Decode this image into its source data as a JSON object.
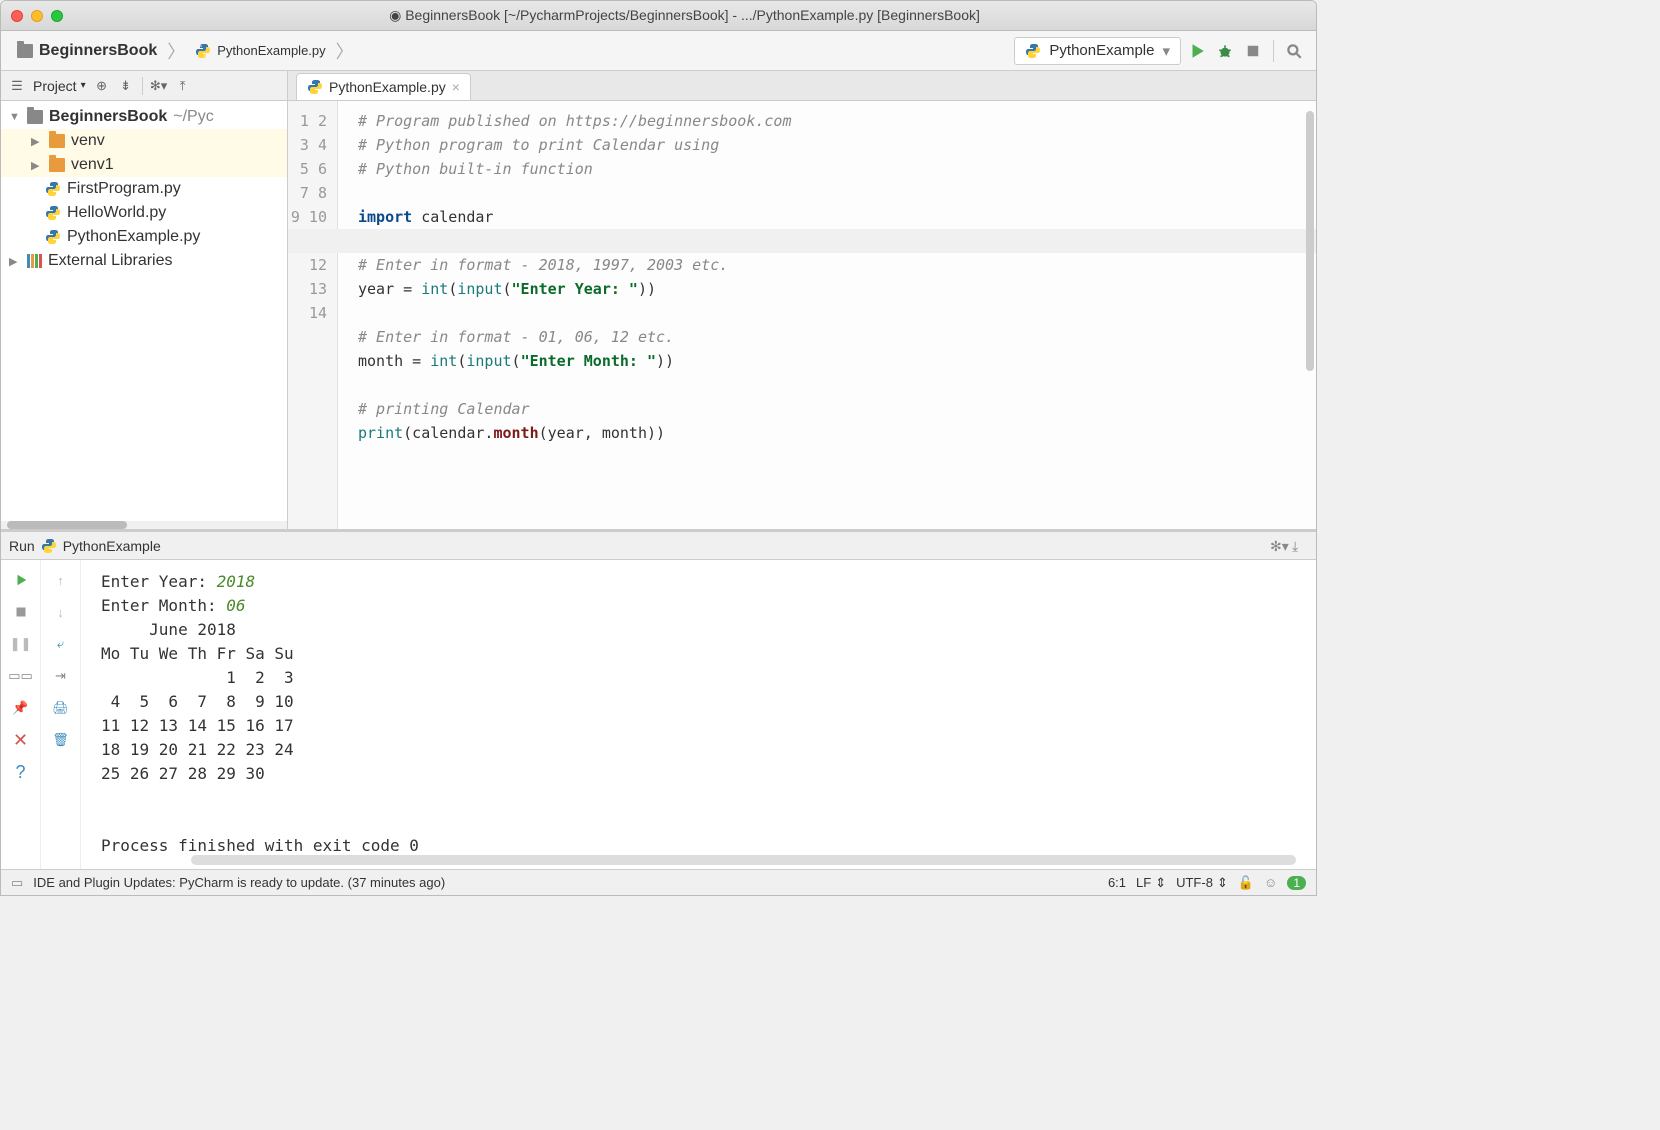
{
  "titlebar": {
    "title": "BeginnersBook [~/PycharmProjects/BeginnersBook] - .../PythonExample.py [BeginnersBook]"
  },
  "breadcrumb": {
    "project": "BeginnersBook",
    "file": "PythonExample.py"
  },
  "run_config": {
    "selected": "PythonExample"
  },
  "project_toolbar": {
    "label": "Project"
  },
  "tree": {
    "root": "BeginnersBook",
    "root_path": "~/PycharmProjects/BeginnersBook",
    "items": [
      {
        "type": "folder",
        "label": "venv",
        "expandable": true
      },
      {
        "type": "folder",
        "label": "venv1",
        "expandable": true
      },
      {
        "type": "pyfile",
        "label": "FirstProgram.py"
      },
      {
        "type": "pyfile",
        "label": "HelloWorld.py"
      },
      {
        "type": "pyfile",
        "label": "PythonExample.py"
      }
    ],
    "external": "External Libraries"
  },
  "editor": {
    "tab": "PythonExample.py",
    "lines_count": 14,
    "code": {
      "l1": "# Program published on https://beginnersbook.com",
      "l2": "# Python program to print Calendar using",
      "l3": "# Python built-in function",
      "l4": "",
      "l5_k": "import",
      "l5_r": " calendar",
      "l6": "",
      "l7": "# Enter in format - 2018, 1997, 2003 etc.",
      "l8_a": "year = ",
      "l8_int": "int",
      "l8_p1": "(",
      "l8_input": "input",
      "l8_p2": "(",
      "l8_s": "\"Enter Year: \"",
      "l8_p3": "))",
      "l9": "",
      "l10": "# Enter in format - 01, 06, 12 etc.",
      "l11_a": "month = ",
      "l11_int": "int",
      "l11_p1": "(",
      "l11_input": "input",
      "l11_p2": "(",
      "l11_s": "\"Enter Month: \"",
      "l11_p3": "))",
      "l12": "",
      "l13": "# printing Calendar",
      "l14_print": "print",
      "l14_p1": "(calendar.",
      "l14_m": "month",
      "l14_p2": "(year, month))"
    }
  },
  "run_panel": {
    "label": "Run",
    "config": "PythonExample",
    "output": {
      "prompt_year": "Enter Year: ",
      "year": "2018",
      "prompt_month": "Enter Month: ",
      "month": "06",
      "cal_title": "     June 2018",
      "cal_head": "Mo Tu We Th Fr Sa Su",
      "cal_w1": "             1  2  3",
      "cal_w2": " 4  5  6  7  8  9 10",
      "cal_w3": "11 12 13 14 15 16 17",
      "cal_w4": "18 19 20 21 22 23 24",
      "cal_w5": "25 26 27 28 29 30",
      "exit": "Process finished with exit code 0"
    }
  },
  "statusbar": {
    "message": "IDE and Plugin Updates: PyCharm is ready to update. (37 minutes ago)",
    "cursor": "6:1",
    "line_sep": "LF",
    "encoding": "UTF-8",
    "badge": "1"
  }
}
